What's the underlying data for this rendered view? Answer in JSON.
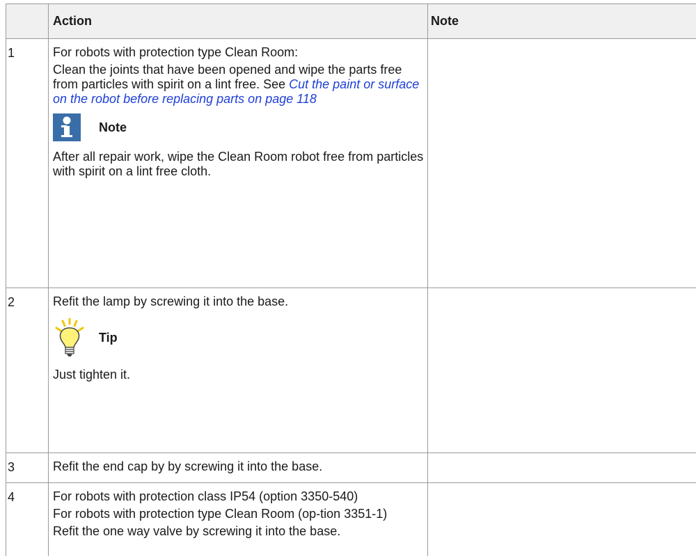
{
  "header": {
    "action": "Action",
    "note": "Note"
  },
  "rows": [
    {
      "num": "1",
      "p1": "For robots with protection type Clean Room:",
      "p2": "Clean the joints that have been opened and wipe the parts free from particles with spirit on a lint free. See ",
      "link": "Cut the paint or surface on the robot before replacing parts on page 118",
      "callout_title": "Note",
      "callout_icon": "info-icon",
      "callout_text": "After all repair work, wipe the Clean Room robot free from particles with spirit on a lint free cloth."
    },
    {
      "num": "2",
      "p1": "Refit the lamp by screwing it into the base.",
      "callout_title": "Tip",
      "callout_icon": "lightbulb-icon",
      "callout_text": "Just tighten it."
    },
    {
      "num": "3",
      "p1": "Refit the end cap by by screwing it into the base."
    },
    {
      "num": "4",
      "p1": "For robots with protection class IP54 (option 3350-540)",
      "p2": "For robots with protection type Clean Room (op-tion 3351-1)",
      "p3": "Refit the one way valve by screwing it into the base."
    }
  ],
  "colors": {
    "header_bg": "#f0f0f0",
    "link": "#1f3fd6",
    "note_icon": "#3a6ea8",
    "tip_bulb": "#fff27a"
  }
}
